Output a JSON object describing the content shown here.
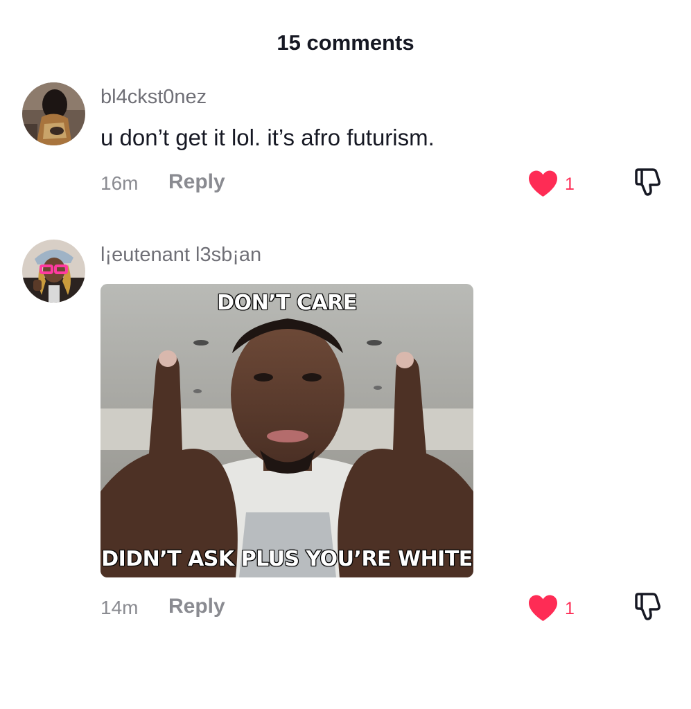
{
  "header": {
    "title": "15 comments"
  },
  "comments": [
    {
      "username": "bl4ckst0nez",
      "text": "u don’t get it lol. it’s afro futurism.",
      "time": "16m",
      "reply_label": "Reply",
      "like_count": "1"
    },
    {
      "username": "l¡eutenant l3sb¡an",
      "image": {
        "top_caption": "DON’T CARE",
        "bottom_caption": "DIDN’T ASK PLUS YOU’RE WHITE"
      },
      "time": "14m",
      "reply_label": "Reply",
      "like_count": "1"
    }
  ],
  "colors": {
    "like": "#fe2c55",
    "muted": "#8a8b91",
    "text": "#161823"
  },
  "icons": [
    "heart-icon",
    "thumbs-down-icon"
  ]
}
